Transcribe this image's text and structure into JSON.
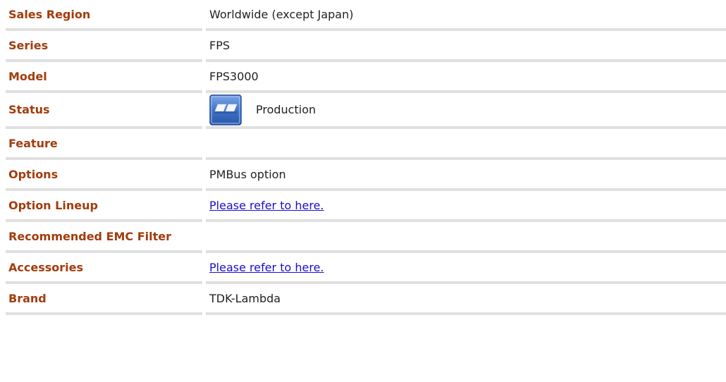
{
  "spec_rows": [
    {
      "label": "Sales Region",
      "value": "Worldwide (except Japan)"
    },
    {
      "label": "Series",
      "value": "FPS"
    },
    {
      "label": "Model",
      "value": "FPS3000"
    },
    {
      "label": "Status",
      "value": "Production",
      "icon": "production-status-icon"
    },
    {
      "label": "Feature",
      "value": ""
    },
    {
      "label": "Options",
      "value": "PMBus option"
    },
    {
      "label": "Option Lineup",
      "link": "Please refer to here."
    },
    {
      "label": "Recommended EMC Filter",
      "value": ""
    },
    {
      "label": "Accessories",
      "link": "Please refer to here."
    },
    {
      "label": "Brand",
      "value": "TDK-Lambda"
    }
  ],
  "colors": {
    "label": "#a23c0c",
    "link": "#1a0dcc",
    "separator": "#e0e0e0",
    "icon_blue": "#2f63b8"
  }
}
